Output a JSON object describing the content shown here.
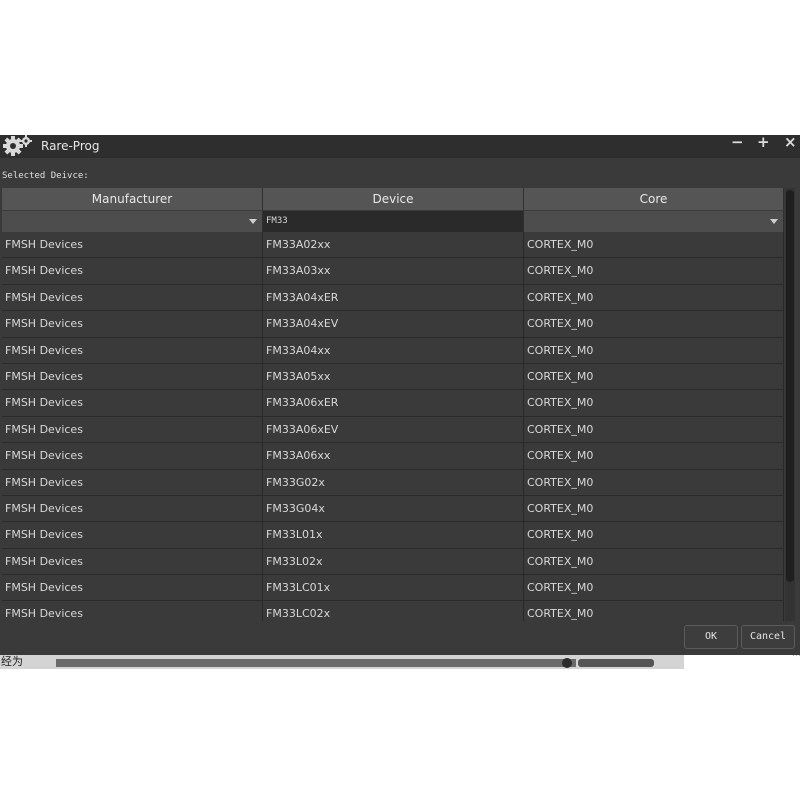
{
  "window": {
    "title": "Rare-Prog",
    "icon": "gear-icon",
    "minimize": "−",
    "maximize": "+",
    "close": "×"
  },
  "selected_label": "Selected Deivce:",
  "columns": [
    "Manufacturer",
    "Device",
    "Core"
  ],
  "filters": {
    "manufacturer": "",
    "device": "FM33",
    "core": ""
  },
  "rows": [
    [
      "FMSH Devices",
      "FM33A02xx",
      "CORTEX_M0"
    ],
    [
      "FMSH Devices",
      "FM33A03xx",
      "CORTEX_M0"
    ],
    [
      "FMSH Devices",
      "FM33A04xER",
      "CORTEX_M0"
    ],
    [
      "FMSH Devices",
      "FM33A04xEV",
      "CORTEX_M0"
    ],
    [
      "FMSH Devices",
      "FM33A04xx",
      "CORTEX_M0"
    ],
    [
      "FMSH Devices",
      "FM33A05xx",
      "CORTEX_M0"
    ],
    [
      "FMSH Devices",
      "FM33A06xER",
      "CORTEX_M0"
    ],
    [
      "FMSH Devices",
      "FM33A06xEV",
      "CORTEX_M0"
    ],
    [
      "FMSH Devices",
      "FM33A06xx",
      "CORTEX_M0"
    ],
    [
      "FMSH Devices",
      "FM33G02x",
      "CORTEX_M0"
    ],
    [
      "FMSH Devices",
      "FM33G04x",
      "CORTEX_M0"
    ],
    [
      "FMSH Devices",
      "FM33L01x",
      "CORTEX_M0"
    ],
    [
      "FMSH Devices",
      "FM33L02x",
      "CORTEX_M0"
    ],
    [
      "FMSH Devices",
      "FM33LC01x",
      "CORTEX_M0"
    ],
    [
      "FMSH Devices",
      "FM33LC02x",
      "CORTEX_M0"
    ]
  ],
  "buttons": {
    "ok": "OK",
    "cancel": "Cancel"
  },
  "background_window": {
    "text": "经为"
  }
}
